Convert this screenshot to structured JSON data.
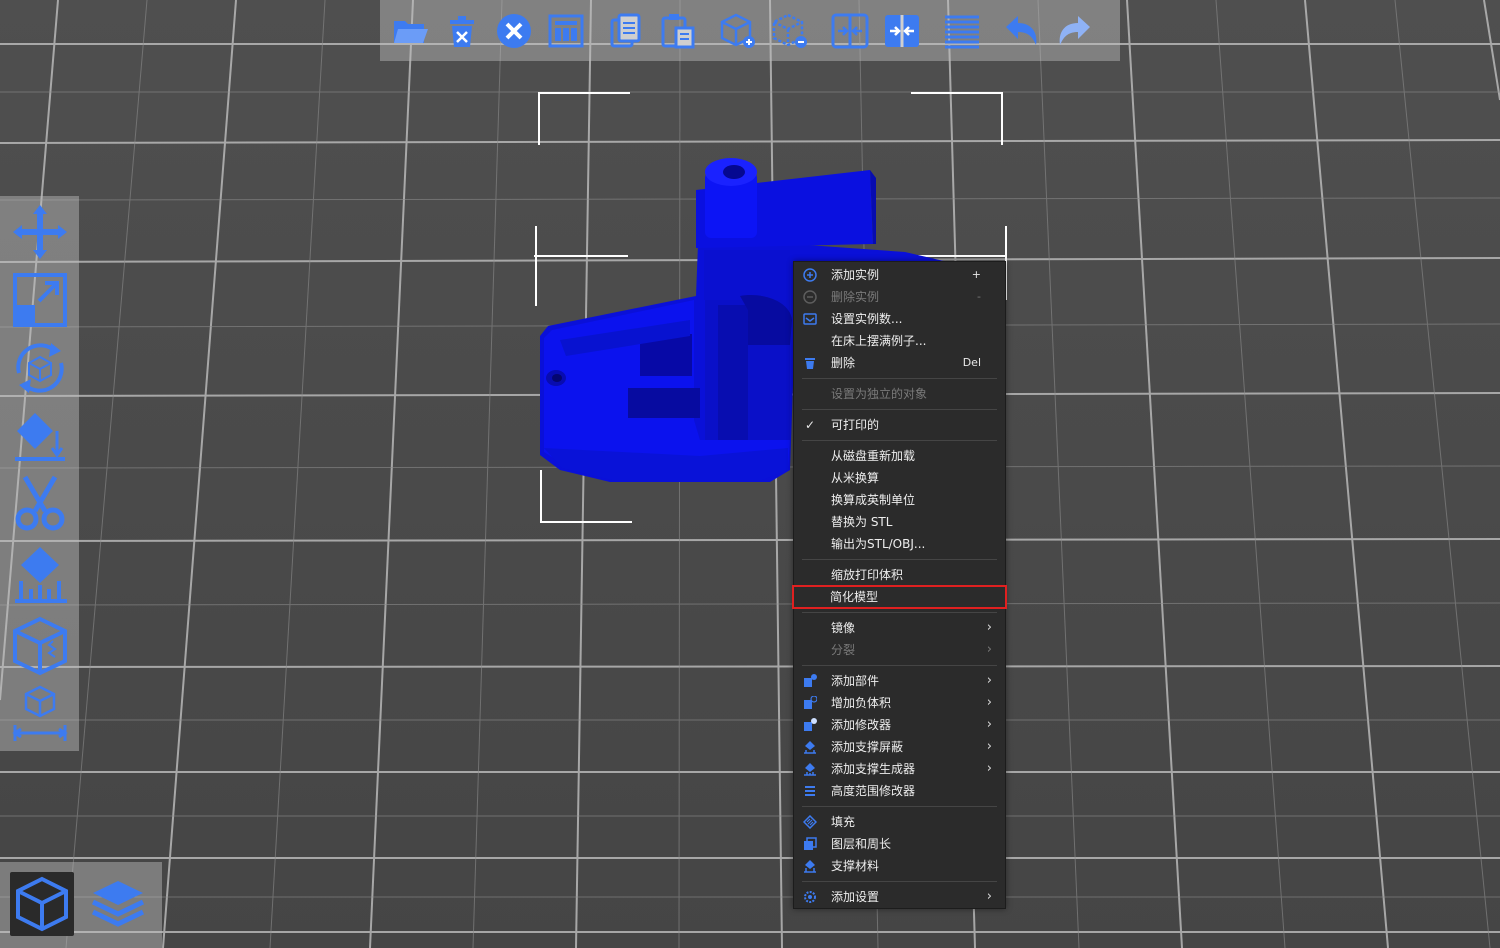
{
  "colors": {
    "accent": "#3d7bf0",
    "model": "#0a10e6",
    "highlight": "#e02020",
    "menu_bg": "#2b2b2b"
  },
  "top_toolbar": {
    "buttons": [
      {
        "name": "open-project",
        "icon": "folder-icon"
      },
      {
        "name": "delete-all",
        "icon": "trash-icon"
      },
      {
        "name": "delete",
        "icon": "close-circle-icon"
      },
      {
        "name": "arrange",
        "icon": "grid-icon"
      },
      {
        "name": "copy",
        "icon": "copy-icon"
      },
      {
        "name": "paste",
        "icon": "paste-icon"
      },
      {
        "name": "add-instance",
        "icon": "cube-plus-icon"
      },
      {
        "name": "remove-instance",
        "icon": "cube-minus-icon"
      },
      {
        "name": "split-objects",
        "icon": "split-objects-icon"
      },
      {
        "name": "split-parts",
        "icon": "split-parts-icon"
      },
      {
        "name": "layers-editing",
        "icon": "layers-icon"
      },
      {
        "name": "undo",
        "icon": "undo-icon"
      },
      {
        "name": "redo",
        "icon": "redo-icon"
      }
    ]
  },
  "left_toolbar": {
    "tools": [
      {
        "name": "move",
        "icon": "move-icon"
      },
      {
        "name": "scale",
        "icon": "scale-icon"
      },
      {
        "name": "rotate",
        "icon": "rotate-icon"
      },
      {
        "name": "place-on-face",
        "icon": "place-on-face-icon"
      },
      {
        "name": "cut",
        "icon": "scissors-icon"
      },
      {
        "name": "support-paint",
        "icon": "support-paint-icon"
      },
      {
        "name": "seam-paint",
        "icon": "seam-icon"
      },
      {
        "name": "measure",
        "icon": "measure-icon"
      }
    ]
  },
  "view_switch": {
    "items": [
      {
        "name": "3d-view",
        "icon": "cube-view-icon",
        "active": true
      },
      {
        "name": "preview",
        "icon": "layers-stack-icon",
        "active": false
      }
    ]
  },
  "context_menu": {
    "items": [
      {
        "type": "item",
        "label": "添加实例",
        "shortcut": "+",
        "icon": "plus-circle-icon"
      },
      {
        "type": "item",
        "label": "删除实例",
        "shortcut": "-",
        "icon": "minus-circle-icon",
        "disabled": true
      },
      {
        "type": "item",
        "label": "设置实例数...",
        "icon": "instances-icon"
      },
      {
        "type": "item",
        "label": "在床上摆满例子..."
      },
      {
        "type": "item",
        "label": "删除",
        "shortcut": "Del",
        "icon": "trash-icon"
      },
      {
        "type": "separator"
      },
      {
        "type": "item",
        "label": "设置为独立的对象",
        "disabled": true
      },
      {
        "type": "separator"
      },
      {
        "type": "item",
        "label": "可打印的",
        "check": "✓"
      },
      {
        "type": "separator"
      },
      {
        "type": "item",
        "label": "从磁盘重新加载"
      },
      {
        "type": "item",
        "label": "从米换算"
      },
      {
        "type": "item",
        "label": "换算成英制单位"
      },
      {
        "type": "item",
        "label": "替换为 STL"
      },
      {
        "type": "item",
        "label": "输出为STL/OBJ..."
      },
      {
        "type": "separator"
      },
      {
        "type": "item",
        "label": "缩放打印体积"
      },
      {
        "type": "item",
        "label": "简化模型",
        "highlighted": true
      },
      {
        "type": "separator"
      },
      {
        "type": "item",
        "label": "镜像",
        "submenu": true
      },
      {
        "type": "item",
        "label": "分裂",
        "submenu": true,
        "disabled": true
      },
      {
        "type": "separator"
      },
      {
        "type": "item",
        "label": "添加部件",
        "submenu": true,
        "icon": "add-part-icon"
      },
      {
        "type": "item",
        "label": "增加负体积",
        "submenu": true,
        "icon": "add-negative-volume-icon"
      },
      {
        "type": "item",
        "label": "添加修改器",
        "submenu": true,
        "icon": "add-modifier-icon"
      },
      {
        "type": "item",
        "label": "添加支撑屏蔽",
        "submenu": true,
        "icon": "support-blocker-icon"
      },
      {
        "type": "item",
        "label": "添加支撑生成器",
        "submenu": true,
        "icon": "support-enforcer-icon"
      },
      {
        "type": "item",
        "label": "高度范围修改器",
        "icon": "height-range-icon"
      },
      {
        "type": "separator"
      },
      {
        "type": "item",
        "label": "填充",
        "icon": "infill-icon"
      },
      {
        "type": "item",
        "label": "图层和周长",
        "icon": "layers-perimeters-icon"
      },
      {
        "type": "item",
        "label": "支撑材料",
        "icon": "support-material-icon"
      },
      {
        "type": "separator"
      },
      {
        "type": "item",
        "label": "添加设置",
        "submenu": true,
        "icon": "settings-gear-icon"
      }
    ]
  }
}
